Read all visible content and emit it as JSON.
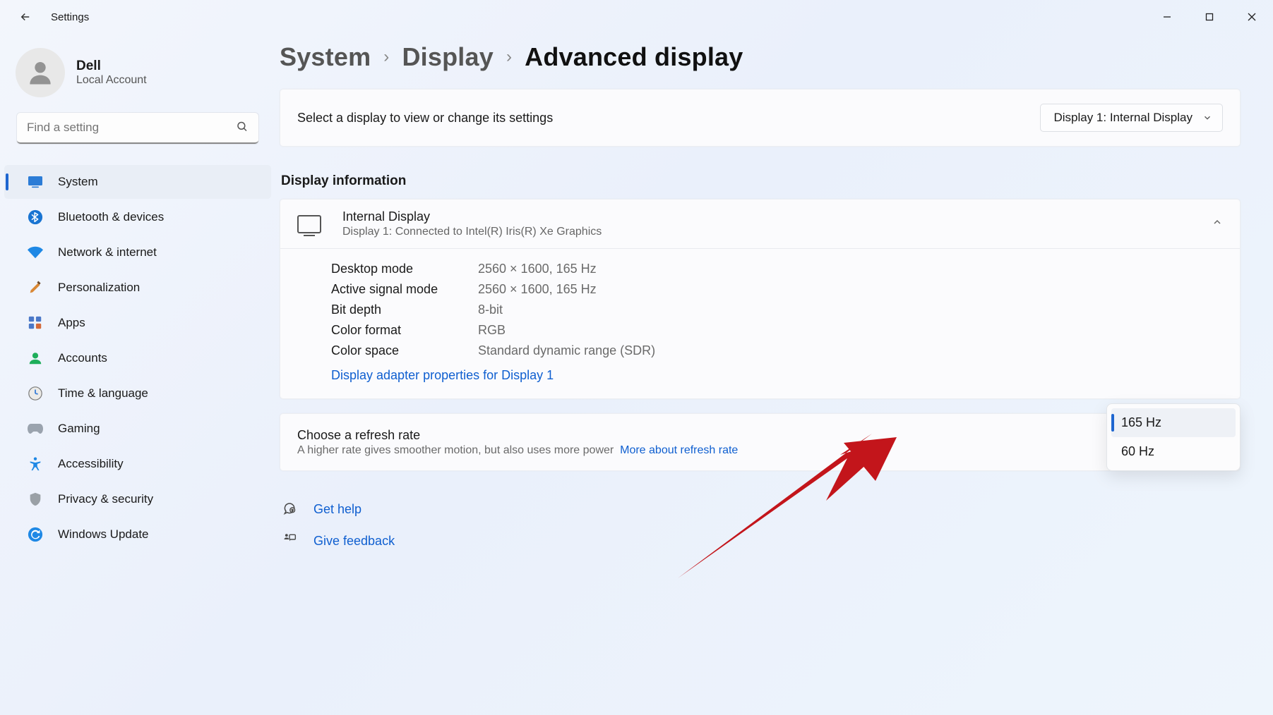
{
  "titlebar": {
    "app_title": "Settings"
  },
  "user": {
    "name": "Dell",
    "subtitle": "Local Account"
  },
  "search": {
    "placeholder": "Find a setting"
  },
  "nav": {
    "items": [
      {
        "label": "System",
        "active": true
      },
      {
        "label": "Bluetooth & devices",
        "active": false
      },
      {
        "label": "Network & internet",
        "active": false
      },
      {
        "label": "Personalization",
        "active": false
      },
      {
        "label": "Apps",
        "active": false
      },
      {
        "label": "Accounts",
        "active": false
      },
      {
        "label": "Time & language",
        "active": false
      },
      {
        "label": "Gaming",
        "active": false
      },
      {
        "label": "Accessibility",
        "active": false
      },
      {
        "label": "Privacy & security",
        "active": false
      },
      {
        "label": "Windows Update",
        "active": false
      }
    ]
  },
  "breadcrumb": {
    "level1": "System",
    "level2": "Display",
    "current": "Advanced display"
  },
  "display_select": {
    "label": "Select a display to view or change its settings",
    "selected": "Display 1: Internal Display"
  },
  "section_heading": "Display information",
  "display_info": {
    "header": {
      "title": "Internal Display",
      "subtitle": "Display 1: Connected to Intel(R) Iris(R) Xe Graphics"
    },
    "rows": {
      "desktop_mode": {
        "k": "Desktop mode",
        "v": "2560 × 1600, 165 Hz"
      },
      "active_signal_mode": {
        "k": "Active signal mode",
        "v": "2560 × 1600, 165 Hz"
      },
      "bit_depth": {
        "k": "Bit depth",
        "v": "8-bit"
      },
      "color_format": {
        "k": "Color format",
        "v": "RGB"
      },
      "color_space": {
        "k": "Color space",
        "v": "Standard dynamic range (SDR)"
      }
    },
    "adapter_link": "Display adapter properties for Display 1"
  },
  "refresh": {
    "title": "Choose a refresh rate",
    "subtitle": "A higher rate gives smoother motion, but also uses more power",
    "more_link": "More about refresh rate",
    "options": [
      {
        "label": "165 Hz",
        "selected": true
      },
      {
        "label": "60 Hz",
        "selected": false
      }
    ]
  },
  "footer": {
    "help": "Get help",
    "feedback": "Give feedback"
  }
}
